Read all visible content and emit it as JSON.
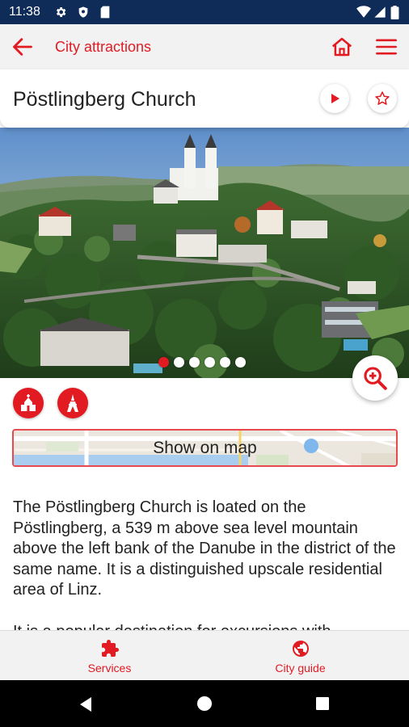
{
  "status_bar": {
    "time": "11:38",
    "left_icons": [
      "gear-icon",
      "shield-icon",
      "sim-card-icon"
    ],
    "right_icons": [
      "wifi-icon",
      "signal-icon",
      "battery-icon"
    ]
  },
  "app_bar": {
    "title": "City attractions",
    "back_icon": "arrow-left-icon",
    "home_icon": "home-icon",
    "menu_icon": "hamburger-menu-icon"
  },
  "attraction": {
    "name": "Pöstlingberg Church",
    "play_icon": "play-icon",
    "favorite_icon": "star-outline-icon"
  },
  "gallery": {
    "image_count": 6,
    "active_index": 0,
    "zoom_icon": "zoom-in-icon"
  },
  "categories": [
    {
      "icon": "church-icon"
    },
    {
      "icon": "tower-icon"
    }
  ],
  "map_button": {
    "label": "Show on map"
  },
  "description": {
    "paragraphs": [
      "The Pöstlingberg Church is loated on the Pöstlingberg, a 539 m above sea level mountain above the left bank of the Danube in the district of the same name. It is a distinguished upscale residential area of Linz.",
      "It is a popular destination for excursions with"
    ]
  },
  "bottom_nav": [
    {
      "label": "Services",
      "icon": "puzzle-icon"
    },
    {
      "label": "City guide",
      "icon": "globe-icon"
    }
  ],
  "system_nav": {
    "back": "triangle-back-icon",
    "home": "circle-home-icon",
    "recents": "square-recents-icon"
  },
  "colors": {
    "accent": "#e21b23",
    "status_bar": "#0f2b57",
    "app_bar": "#f2f2f2"
  }
}
